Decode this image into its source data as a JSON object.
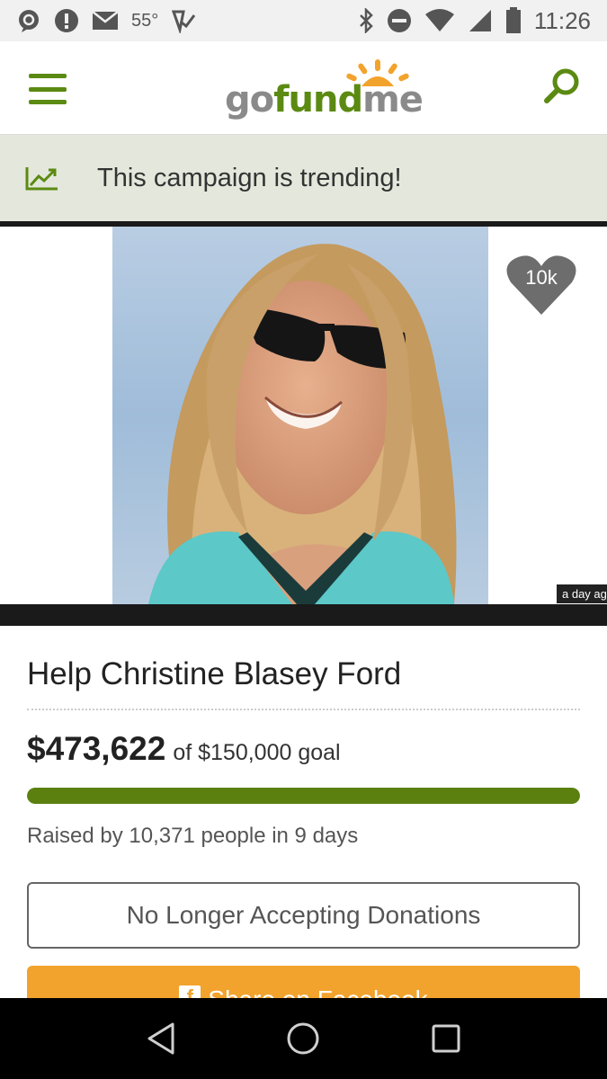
{
  "status_bar": {
    "temperature": "55°",
    "time": "11:26",
    "left_icons": [
      "chat-icon",
      "alert-icon",
      "mail-icon",
      "temperature",
      "checkmark-icon"
    ],
    "right_icons": [
      "bluetooth-icon",
      "do-not-disturb-icon",
      "wifi-icon",
      "signal-icon",
      "battery-icon"
    ]
  },
  "header": {
    "logo": "gofundme",
    "logo_parts": {
      "go": "go",
      "fund": "fund",
      "me": "me"
    },
    "accent_color": "#5b8a12"
  },
  "trending": {
    "text": "This campaign is trending!",
    "icon": "trending-chart-icon"
  },
  "photo": {
    "heart_count": "10k",
    "timestamp": "a day ago"
  },
  "campaign": {
    "title": "Help Christine Blasey Ford",
    "amount_raised": "$473,622",
    "goal_text": "of $150,000 goal",
    "progress_fraction": 1.0,
    "raised_by": "Raised by 10,371 people in 9 days",
    "no_donations_label": "No Longer Accepting Donations",
    "share_label": "Share on Facebook"
  },
  "nav_bar": {
    "buttons": [
      "back-icon",
      "home-icon",
      "recents-icon"
    ]
  }
}
